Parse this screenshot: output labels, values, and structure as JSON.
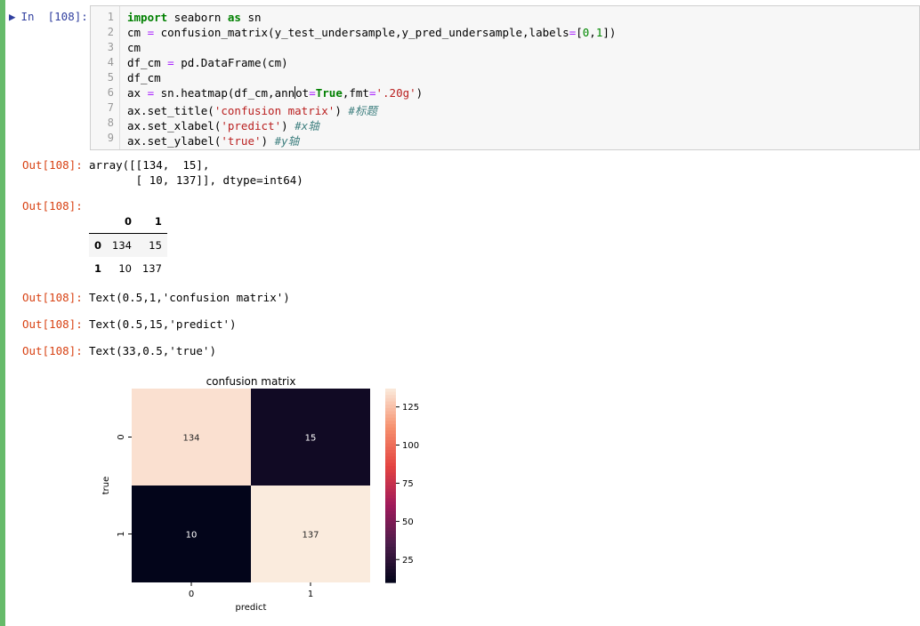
{
  "input_cell": {
    "prompt_label": "In  [108]:",
    "line_numbers": [
      "1",
      "2",
      "3",
      "4",
      "5",
      "6",
      "7",
      "8",
      "9"
    ]
  },
  "outputs": {
    "prompt_1": "Out[108]:",
    "array_line_1": "array([[134,  15],",
    "array_line_2": "       [ 10, 137]], dtype=int64)",
    "prompt_2": "Out[108]:",
    "dataframe": {
      "columns": [
        "0",
        "1"
      ],
      "rows": [
        {
          "index": "0",
          "cells": [
            "134",
            "15"
          ]
        },
        {
          "index": "1",
          "cells": [
            "10",
            "137"
          ]
        }
      ]
    },
    "prompt_3": "Out[108]:",
    "text_title": "Text(0.5,1,'confusion matrix')",
    "prompt_4": "Out[108]:",
    "text_xlabel": "Text(0.5,15,'predict')",
    "prompt_5": "Out[108]:",
    "text_ylabel": "Text(33,0.5,'true')"
  },
  "chart_data": {
    "type": "heatmap",
    "title": "confusion matrix",
    "xlabel": "predict",
    "ylabel": "true",
    "x_categories": [
      "0",
      "1"
    ],
    "y_categories": [
      "0",
      "1"
    ],
    "values": [
      [
        134,
        15
      ],
      [
        10,
        137
      ]
    ],
    "colorbar": {
      "range": [
        10,
        137
      ],
      "ticks": [
        25,
        50,
        75,
        100,
        125
      ],
      "colormap": "rocket"
    }
  }
}
